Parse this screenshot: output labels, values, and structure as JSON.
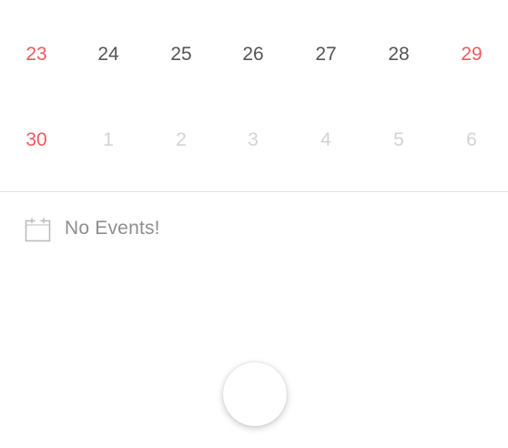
{
  "calendar": {
    "weeks": [
      {
        "days": [
          "23",
          "24",
          "25",
          "26",
          "27",
          "28",
          "29"
        ]
      },
      {
        "days": [
          "30",
          "1",
          "2",
          "3",
          "4",
          "5",
          "6"
        ]
      }
    ],
    "weekend_color": "#f0585f",
    "day_color": "#555555",
    "muted_day_color": "#d3d3d3"
  },
  "events": {
    "icon": "calendar-icon",
    "empty_text": "No Events!"
  },
  "fab": {
    "icon": "none"
  }
}
